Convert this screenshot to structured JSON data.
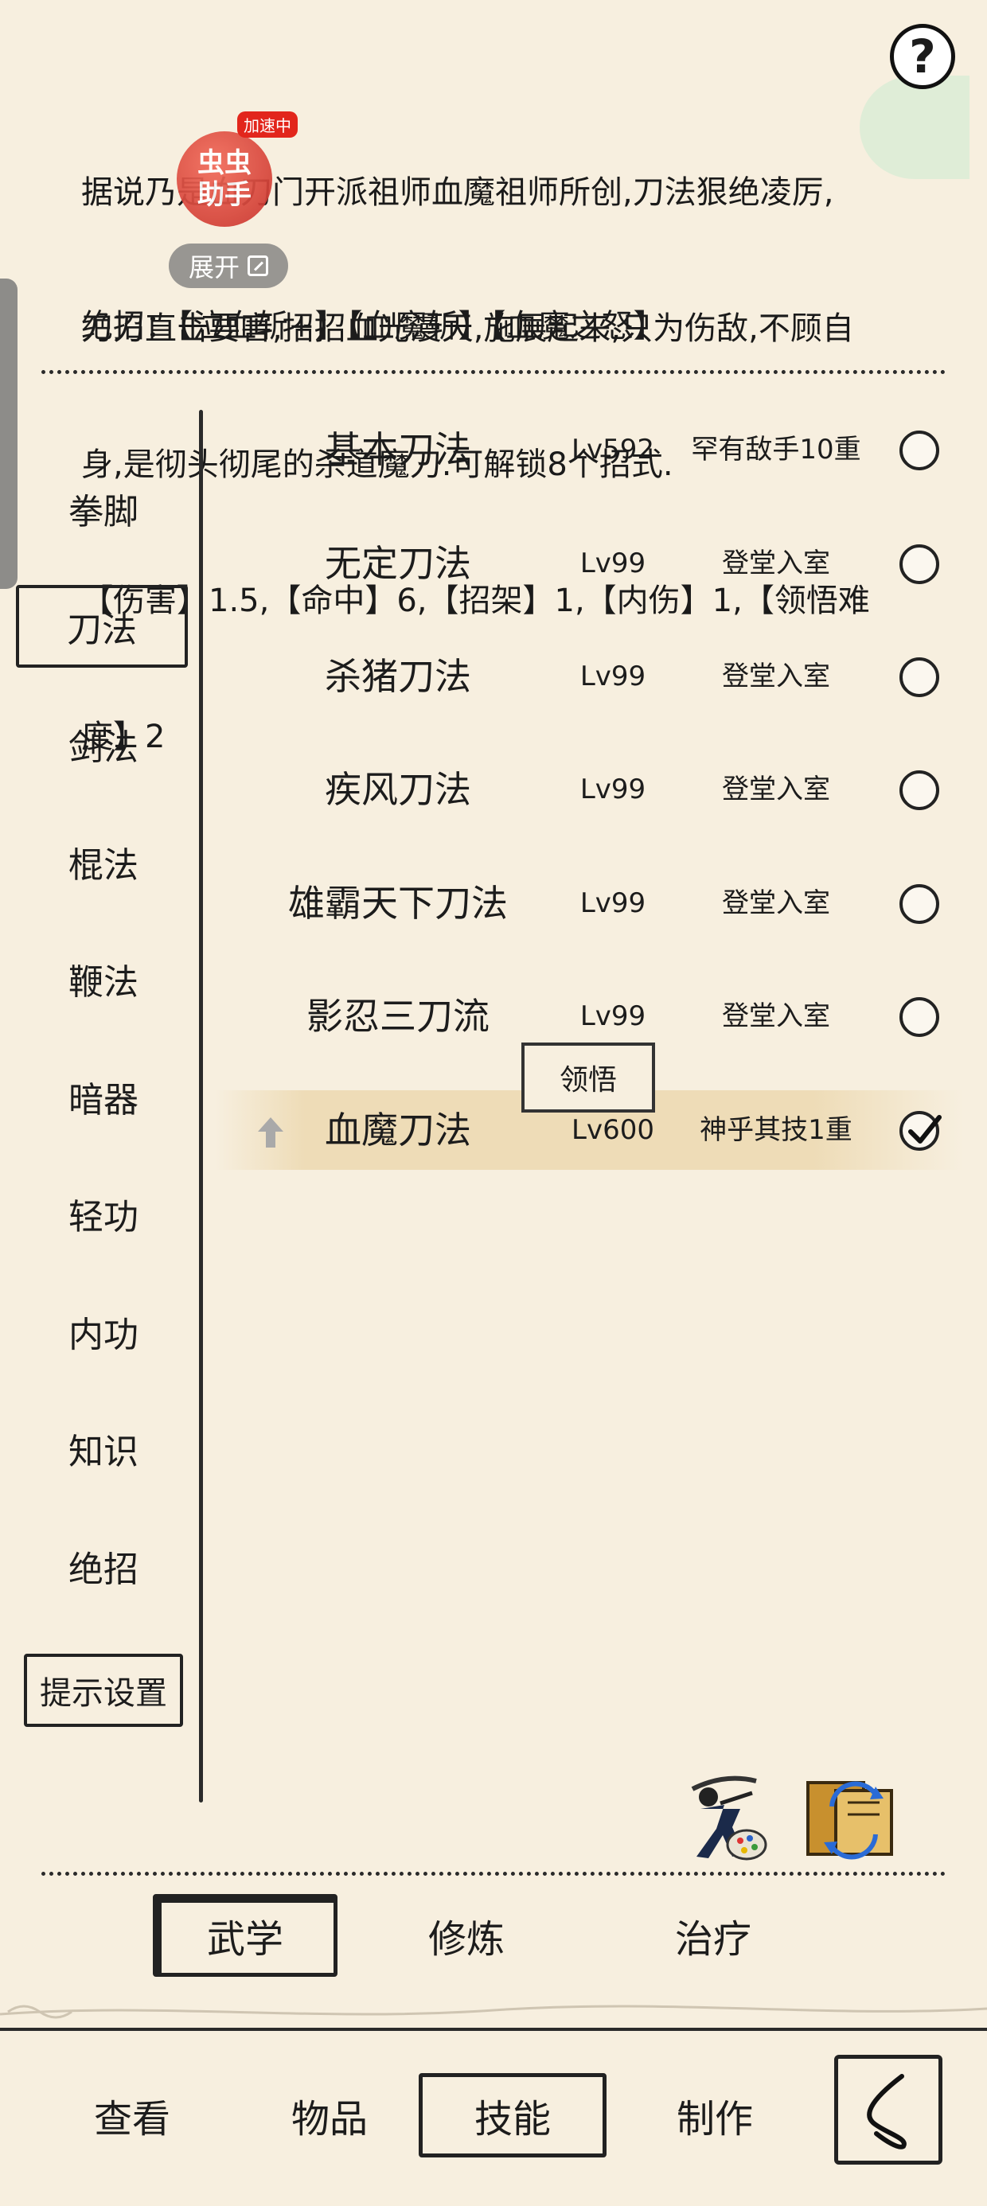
{
  "overlay": {
    "assist_tag": "加速中",
    "assist_line1": "虫虫",
    "assist_line2": "助手",
    "expand_label": "展开"
  },
  "description": {
    "line1": "据说乃是血刀门开派祖师血魔祖师所创,刀法狠绝凌厉,",
    "line2": "刀刀直击要害,招招血光漫天,施展起来,只为伤敌,不顾自",
    "line3": "身,是彻头彻尾的杀道魔刀.可解锁8个招式.",
    "line4": "【伤害】1.5,【命中】6,【招架】1,【内伤】1,【领悟难",
    "line5": "度】2",
    "ultimates": "绝招：【泣血斩+】【血魔斩】【血魔之怒】"
  },
  "categories": [
    {
      "label": "拳脚",
      "active": false
    },
    {
      "label": "刀法",
      "active": true
    },
    {
      "label": "剑法",
      "active": false
    },
    {
      "label": "棍法",
      "active": false
    },
    {
      "label": "鞭法",
      "active": false
    },
    {
      "label": "暗器",
      "active": false
    },
    {
      "label": "轻功",
      "active": false
    },
    {
      "label": "内功",
      "active": false
    },
    {
      "label": "知识",
      "active": false
    },
    {
      "label": "绝招",
      "active": false
    }
  ],
  "hint_settings_label": "提示设置",
  "skills": [
    {
      "name": "基本刀法",
      "level": "Lv592",
      "rank": "罕有敌手10重",
      "checked": false
    },
    {
      "name": "无定刀法",
      "level": "Lv99",
      "rank": "登堂入室",
      "checked": false
    },
    {
      "name": "杀猪刀法",
      "level": "Lv99",
      "rank": "登堂入室",
      "checked": false
    },
    {
      "name": "疾风刀法",
      "level": "Lv99",
      "rank": "登堂入室",
      "checked": false
    },
    {
      "name": "雄霸天下刀法",
      "level": "Lv99",
      "rank": "登堂入室",
      "checked": false
    },
    {
      "name": "影忍三刀流",
      "level": "Lv99",
      "rank": "登堂入室",
      "checked": false
    },
    {
      "name": "血魔刀法",
      "level": "Lv600",
      "rank": "神乎其技1重",
      "checked": true
    }
  ],
  "comprehend_label": "领悟",
  "subtabs": [
    {
      "label": "武学",
      "active": true
    },
    {
      "label": "修炼",
      "active": false
    },
    {
      "label": "治疗",
      "active": false
    }
  ],
  "maintabs": [
    {
      "label": "查看",
      "active": false
    },
    {
      "label": "物品",
      "active": false
    },
    {
      "label": "技能",
      "active": true
    },
    {
      "label": "制作",
      "active": false
    }
  ],
  "icons": {
    "help": "question-mark",
    "martial_art": "swordsman-palette-icon",
    "swap": "book-swap-icon",
    "back": "back-chevron-icon"
  },
  "colors": {
    "background": "#f7efdf",
    "highlight": "#eedcb7",
    "ink": "#1c1c1c"
  }
}
